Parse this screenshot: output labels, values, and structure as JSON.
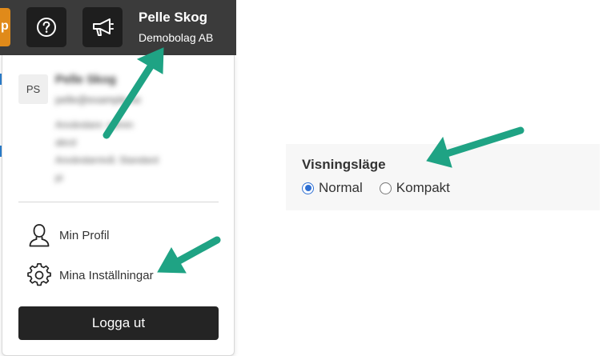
{
  "topbar": {
    "orange_tab_glyph": "p",
    "help_icon": "question-circle-icon",
    "news_icon": "megaphone-icon",
    "user_name": "Pelle Skog",
    "company": "Demobolag AB"
  },
  "dropdown": {
    "avatar_initials": "PS",
    "blurred": {
      "name": "Pelle Skog",
      "email": "pelle@example.se",
      "line1": "Användare: admin",
      "line2": "abcd",
      "line3": "Användarnivå: Standard",
      "line4": "pi"
    },
    "menu": [
      {
        "label": "Min Profil",
        "icon": "user-profile-icon"
      },
      {
        "label": "Mina Inställningar",
        "icon": "gear-icon"
      }
    ],
    "logout_label": "Logga ut"
  },
  "settings": {
    "title": "Visningsläge",
    "options": [
      {
        "label": "Normal",
        "checked": true
      },
      {
        "label": "Kompakt",
        "checked": false
      }
    ]
  },
  "colors": {
    "topbar": "#3b3b3b",
    "accent_orange": "#e08a1a",
    "arrow_green": "#1fa384",
    "radio_blue": "#2e6fd3",
    "button_dark": "#242424"
  }
}
